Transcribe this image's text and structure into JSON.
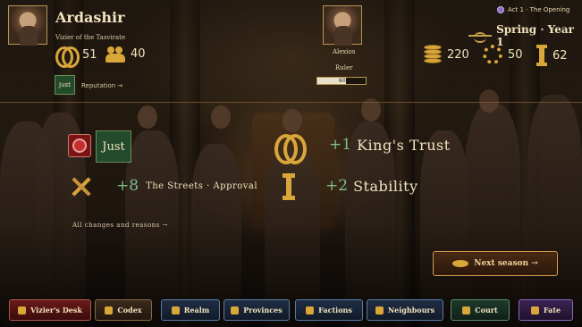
{
  "player": {
    "name": "Ardashir",
    "title": "Vizier of the Tasvirate",
    "trust": "51",
    "soldiers": "40",
    "reputation_badge": "Just",
    "reputation_link": "Reputation →"
  },
  "ruler": {
    "name": "Alexios",
    "role": "Ruler",
    "bar_label": "60",
    "bar_fraction": 0.6
  },
  "status": {
    "act": "Act 1 · The Opening",
    "season": "Spring · Year 1",
    "gold": "220",
    "approval": "50",
    "stability": "62"
  },
  "results": {
    "choice_label": "Just",
    "trust_delta": "+1",
    "trust_name": "King's Trust",
    "streets_delta": "+8",
    "streets_name": "The Streets · Approval",
    "stability_delta": "+2",
    "stability_name": "Stability",
    "all_changes_link": "All changes and reasons →"
  },
  "next_button": "Next season →",
  "nav": [
    {
      "label": "Vizier's Desk"
    },
    {
      "label": "Codex"
    },
    {
      "label": "Realm"
    },
    {
      "label": "Provinces"
    },
    {
      "label": "Factions"
    },
    {
      "label": "Neighbours"
    },
    {
      "label": "Court"
    },
    {
      "label": "Fate"
    }
  ],
  "icons": {
    "trust": "rings-icon",
    "soldiers": "helmet-icon",
    "gold": "coins-icon",
    "approval": "wreath-icon",
    "stability": "pillar-icon"
  },
  "colors": {
    "accent_gold": "#d9a63a",
    "positive": "#7fbe87",
    "just_green": "#234a2a"
  }
}
